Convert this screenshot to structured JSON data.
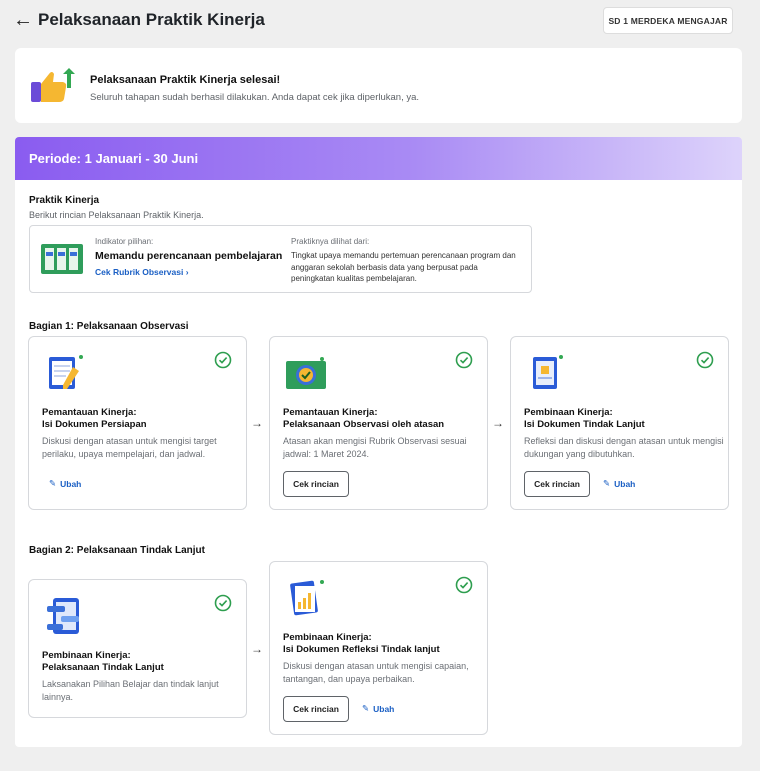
{
  "header": {
    "title": "Pelaksanaan Praktik Kinerja",
    "school_button": "SD 1 MERDEKA MENGAJAR"
  },
  "banner": {
    "title": "Pelaksanaan Praktik Kinerja selesai!",
    "subtitle": "Seluruh tahapan sudah berhasil dilakukan. Anda dapat cek jika diperlukan, ya."
  },
  "period": {
    "label": "Periode: 1 Januari - 30 Juni"
  },
  "praktik": {
    "title": "Praktik Kinerja",
    "subtitle": "Berikut rincian Pelaksanaan Praktik Kinerja.",
    "indicator_label": "Indikator pilihan:",
    "indicator_value": "Memandu perencanaan pembelajaran",
    "indicator_link": "Cek Rubrik Observasi",
    "seen_label": "Praktiknya dilihat dari:",
    "seen_text": "Tingkat upaya memandu pertemuan perencanaan program dan anggaran sekolah berbasis data yang berpusat pada peningkatan kualitas pembelajaran."
  },
  "bagian1": {
    "title": "Bagian 1: Pelaksanaan Observasi",
    "cards": [
      {
        "title1": "Pemantauan Kinerja:",
        "title2": "Isi Dokumen Persiapan",
        "desc": "Diskusi dengan atasan untuk mengisi target perilaku, upaya mempelajari, dan jadwal.",
        "edit": "Ubah"
      },
      {
        "title1": "Pemantauan Kinerja:",
        "title2": "Pelaksanaan Observasi oleh atasan",
        "desc": "Atasan akan mengisi Rubrik Observasi sesuai jadwal: 1 Maret 2024.",
        "button": "Cek rincian"
      },
      {
        "title1": "Pembinaan Kinerja:",
        "title2": "Isi Dokumen Tindak Lanjut",
        "desc": "Refleksi dan diskusi dengan atasan untuk mengisi dukungan yang dibutuhkan.",
        "button": "Cek rincian",
        "edit": "Ubah"
      }
    ]
  },
  "bagian2": {
    "title": "Bagian 2: Pelaksanaan Tindak Lanjut",
    "cards": [
      {
        "title1": "Pembinaan Kinerja:",
        "title2": "Pelaksanaan Tindak Lanjut",
        "desc": "Laksanakan Pilihan Belajar dan tindak lanjut lainnya."
      },
      {
        "title1": "Pembinaan Kinerja:",
        "title2": "Isi Dokumen Refleksi Tindak lanjut",
        "desc": "Diskusi dengan atasan untuk mengisi capaian, tantangan, dan upaya perbaikan.",
        "button": "Cek rincian",
        "edit": "Ubah"
      }
    ]
  },
  "colors": {
    "accent": "#8a5cf0",
    "link": "#1a5fc4",
    "success": "#2e9e4f"
  }
}
